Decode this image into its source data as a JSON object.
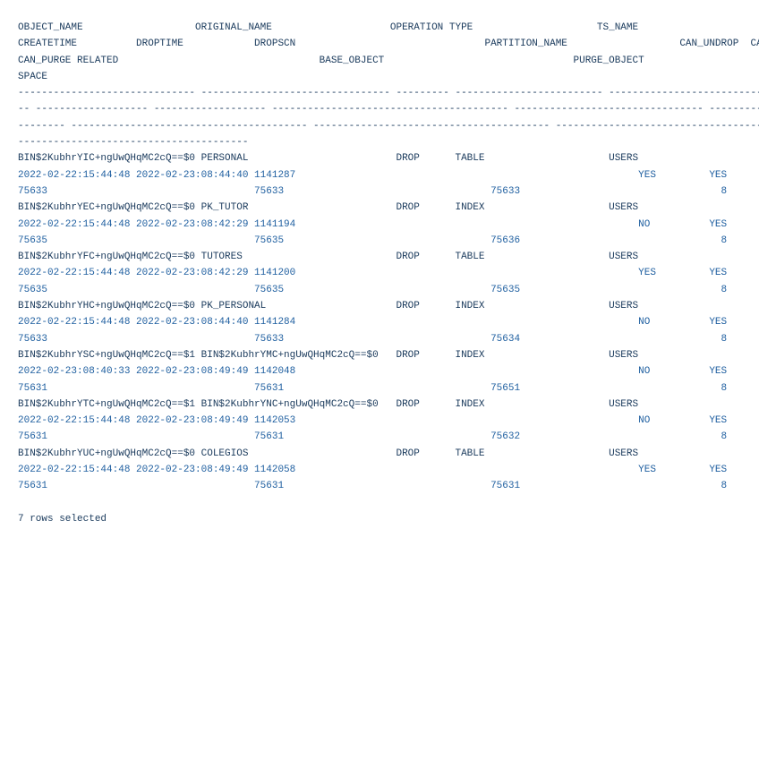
{
  "header_lines": [
    "OBJECT_NAME                   ORIGINAL_NAME                    OPERATION TYPE                     TS_NAME",
    "CREATETIME          DROPTIME            DROPSCN                                PARTITION_NAME                   CAN_UNDROP  CAN_PURGE",
    "CAN_PURGE RELATED                                  BASE_OBJECT                                PURGE_OBJECT",
    "SPACE"
  ],
  "separator_lines": [
    "------------------------------ -------------------------------- --------- ------------------------- ------------------------------",
    "-- ------------------- ------------------- ---------------------------------------- -------------------------------- ----------",
    "-------- ---------------------------------------- ---------------------------------------- ----------------------------------------",
    "---------------------------------------"
  ],
  "rows": [
    {
      "line1": "BIN$2KubhrYIC+ngUwQHqMC2cQ==$0 PERSONAL                         DROP      TABLE                     USERS",
      "line2": "2022-02-22:15:44:48 2022-02-23:08:44:40 1141287                                                          YES         YES",
      "line3": "75633                                   75633                                   75633                                  8"
    },
    {
      "line1": "BIN$2KubhrYEC+ngUwQHqMC2cQ==$0 PK_TUTOR                         DROP      INDEX                     USERS",
      "line2": "2022-02-22:15:44:48 2022-02-23:08:42:29 1141194                                                          NO          YES",
      "line3": "75635                                   75635                                   75636                                  8"
    },
    {
      "line1": "BIN$2KubhrYFC+ngUwQHqMC2cQ==$0 TUTORES                          DROP      TABLE                     USERS",
      "line2": "2022-02-22:15:44:48 2022-02-23:08:42:29 1141200                                                          YES         YES",
      "line3": "75635                                   75635                                   75635                                  8"
    },
    {
      "line1": "BIN$2KubhrYHC+ngUwQHqMC2cQ==$0 PK_PERSONAL                      DROP      INDEX                     USERS",
      "line2": "2022-02-22:15:44:48 2022-02-23:08:44:40 1141284                                                          NO          YES",
      "line3": "75633                                   75633                                   75634                                  8"
    },
    {
      "line1": "BIN$2KubhrYSC+ngUwQHqMC2cQ==$1 BIN$2KubhrYMC+ngUwQHqMC2cQ==$0   DROP      INDEX                     USERS",
      "line2": "2022-02-23:08:40:33 2022-02-23:08:49:49 1142048                                                          NO          YES",
      "line3": "75631                                   75631                                   75651                                  8"
    },
    {
      "line1": "BIN$2KubhrYTC+ngUwQHqMC2cQ==$1 BIN$2KubhrYNC+ngUwQHqMC2cQ==$0   DROP      INDEX                     USERS",
      "line2": "2022-02-22:15:44:48 2022-02-23:08:49:49 1142053                                                          NO          YES",
      "line3": "75631                                   75631                                   75632                                  8"
    },
    {
      "line1": "BIN$2KubhrYUC+ngUwQHqMC2cQ==$0 COLEGIOS                         DROP      TABLE                     USERS",
      "line2": "2022-02-22:15:44:48 2022-02-23:08:49:49 1142058                                                          YES         YES",
      "line3": "75631                                   75631                                   75631                                  8"
    }
  ],
  "footer": "7 rows selected"
}
